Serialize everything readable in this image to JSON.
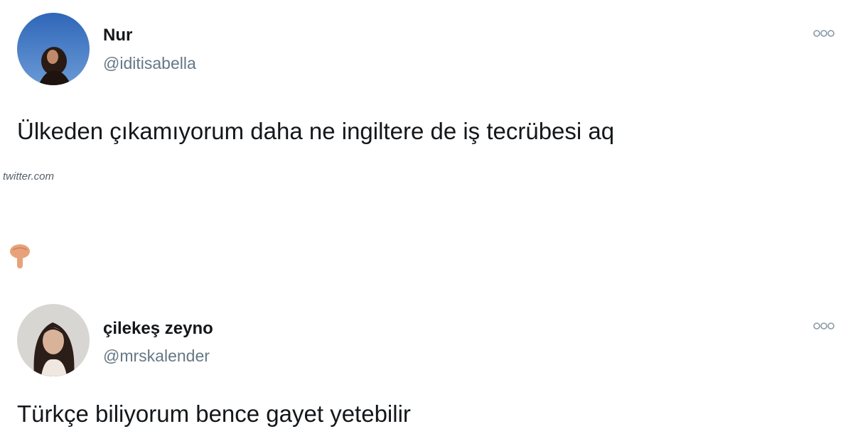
{
  "tweet_1": {
    "avatar_icon": "user-avatar",
    "display_name": "Nur",
    "handle": "@iditisabella",
    "more_icon": "more-options-icon",
    "text": "Ülkeden çıkamıyorum daha ne ingiltere de iş tecrübesi aq"
  },
  "source_label": "twitter.com",
  "separator_icon": "pointing-down-hand-icon",
  "tweet_2": {
    "avatar_icon": "user-avatar",
    "display_name": "çilekeş zeyno",
    "handle": "@mrskalender",
    "more_icon": "more-options-icon",
    "text": "Türkçe biliyorum bence gayet yetebilir"
  },
  "colors": {
    "text_primary": "#14171a",
    "text_secondary": "#657786",
    "background": "#ffffff",
    "hand_emoji": "#e8a27a"
  }
}
